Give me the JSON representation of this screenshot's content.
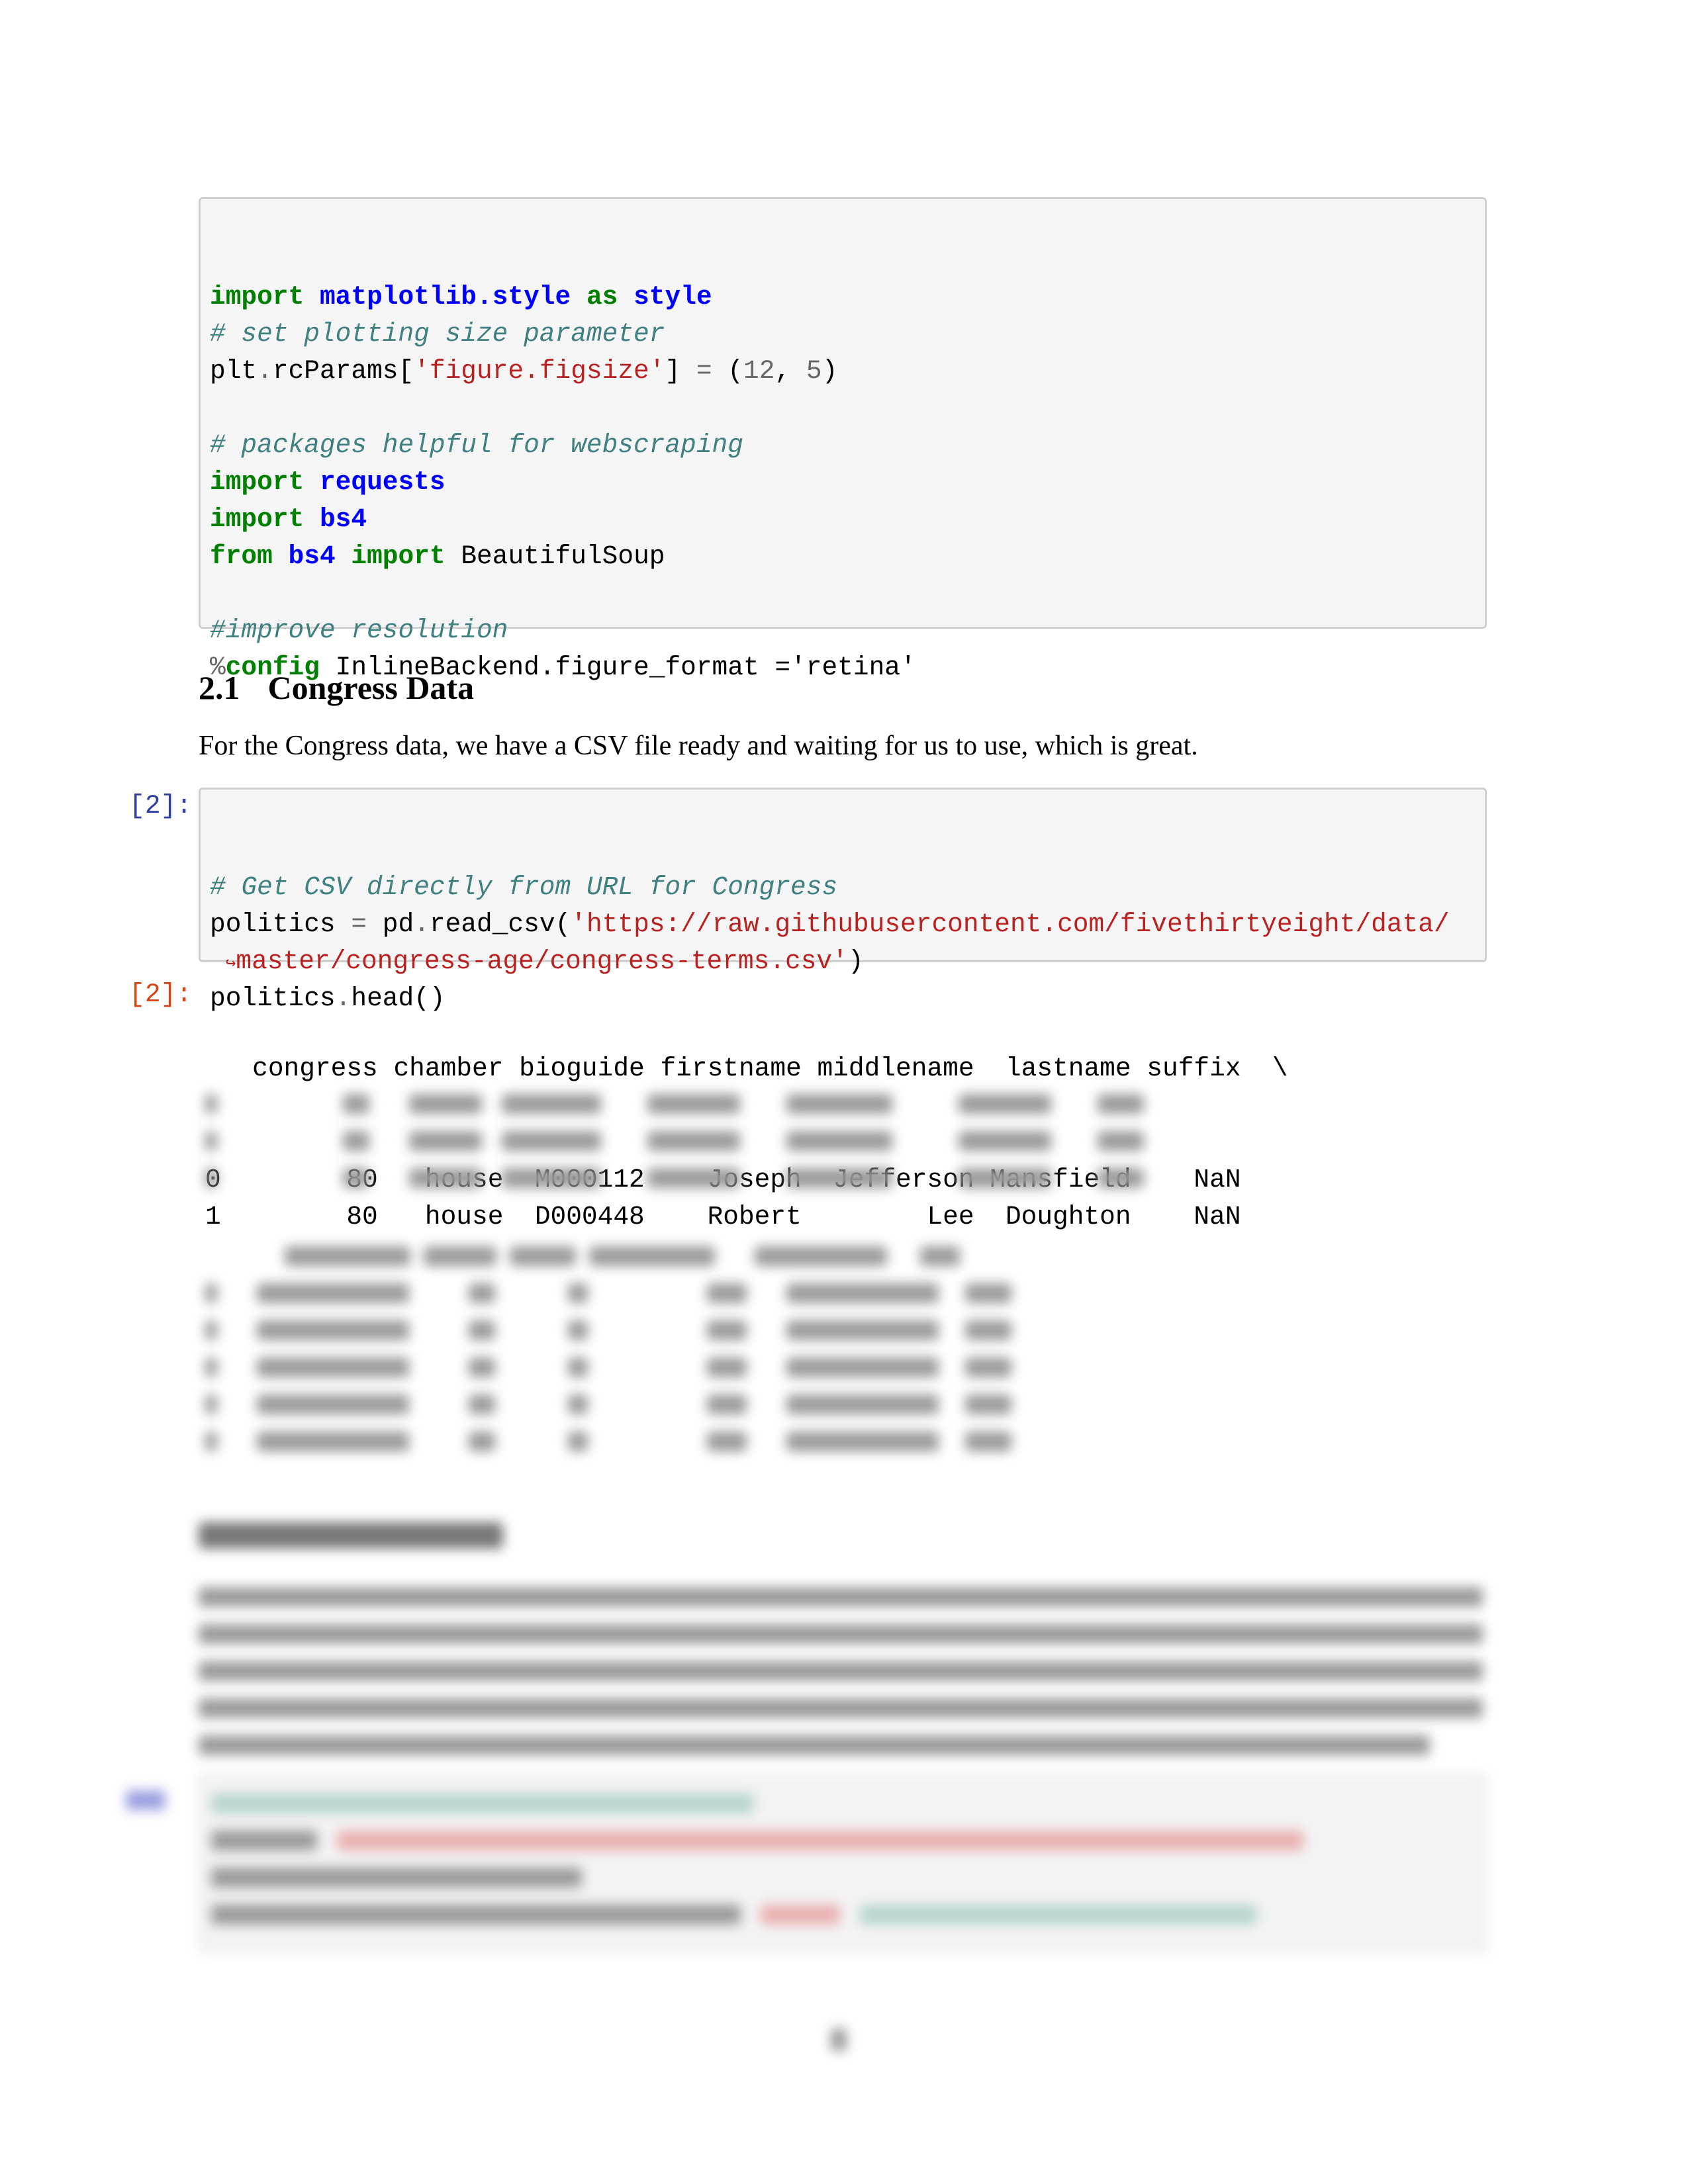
{
  "cells": {
    "setup": {
      "lines": [
        [
          {
            "t": "import",
            "k": "kw"
          },
          {
            "t": " "
          },
          {
            "t": "matplotlib.style",
            "k": "nn"
          },
          {
            "t": " "
          },
          {
            "t": "as",
            "k": "kw"
          },
          {
            "t": " "
          },
          {
            "t": "style",
            "k": "nn"
          }
        ],
        [
          {
            "t": "# set plotting size parameter",
            "k": "c"
          }
        ],
        [
          {
            "t": "plt"
          },
          {
            "t": ".",
            "k": "o"
          },
          {
            "t": "rcParams["
          },
          {
            "t": "'figure.figsize'",
            "k": "s"
          },
          {
            "t": "] "
          },
          {
            "t": "=",
            "k": "o"
          },
          {
            "t": " ("
          },
          {
            "t": "12",
            "k": "m"
          },
          {
            "t": ", "
          },
          {
            "t": "5",
            "k": "m"
          },
          {
            "t": ")"
          }
        ],
        [
          {
            "t": ""
          }
        ],
        [
          {
            "t": "# packages helpful for webscraping",
            "k": "c"
          }
        ],
        [
          {
            "t": "import",
            "k": "kw"
          },
          {
            "t": " "
          },
          {
            "t": "requests",
            "k": "nn"
          }
        ],
        [
          {
            "t": "import",
            "k": "kw"
          },
          {
            "t": " "
          },
          {
            "t": "bs4",
            "k": "nn"
          }
        ],
        [
          {
            "t": "from",
            "k": "kw"
          },
          {
            "t": " "
          },
          {
            "t": "bs4",
            "k": "nn"
          },
          {
            "t": " "
          },
          {
            "t": "import",
            "k": "kw"
          },
          {
            "t": " BeautifulSoup"
          }
        ],
        [
          {
            "t": ""
          }
        ],
        [
          {
            "t": "#improve resolution",
            "k": "c"
          }
        ],
        [
          {
            "t": "%",
            "k": "o"
          },
          {
            "t": "config",
            "k": "kw"
          },
          {
            "t": " InlineBackend.figure_format ='retina'"
          }
        ]
      ]
    },
    "congress": {
      "prompt": "[2]:",
      "lines": [
        [
          {
            "t": "# Get CSV directly from URL for Congress",
            "k": "c"
          }
        ],
        [
          {
            "t": "politics "
          },
          {
            "t": "=",
            "k": "o"
          },
          {
            "t": " pd"
          },
          {
            "t": ".",
            "k": "o"
          },
          {
            "t": "read_csv("
          },
          {
            "t": "'https://raw.githubusercontent.com/fivethirtyeight/data/",
            "k": "s"
          }
        ],
        [
          {
            "t": " "
          },
          {
            "t": "↪",
            "k": "cont"
          },
          {
            "t": "master/congress-age/congress-terms.csv'",
            "k": "s"
          },
          {
            "t": ")"
          }
        ],
        [
          {
            "t": "politics"
          },
          {
            "t": ".",
            "k": "o"
          },
          {
            "t": "head()"
          }
        ]
      ]
    },
    "future": {
      "prompt": "[3]:"
    }
  },
  "section": {
    "heading_number": "2.1",
    "heading_title": "Congress Data",
    "paragraph": "For the Congress data, we have a CSV file ready and waiting for us to use, which is great."
  },
  "output": {
    "prompt": "[2]:",
    "columns": [
      "congress",
      "chamber",
      "bioguide",
      "firstname",
      "middlename",
      "lastname",
      "suffix"
    ],
    "continuation": "\\",
    "rows": [
      {
        "index": "0",
        "congress": "80",
        "chamber": "house",
        "bioguide": "M000112",
        "firstname": "Joseph",
        "middlename": "Jefferson",
        "lastname": "Mansfield",
        "suffix": "NaN"
      },
      {
        "index": "1",
        "congress": "80",
        "chamber": "house",
        "bioguide": "D000448",
        "firstname": "Robert",
        "middlename": "Lee",
        "lastname": "Doughton",
        "suffix": "NaN"
      }
    ],
    "blurred_rows_count": 3,
    "blurred_second_table_rows": 5
  }
}
